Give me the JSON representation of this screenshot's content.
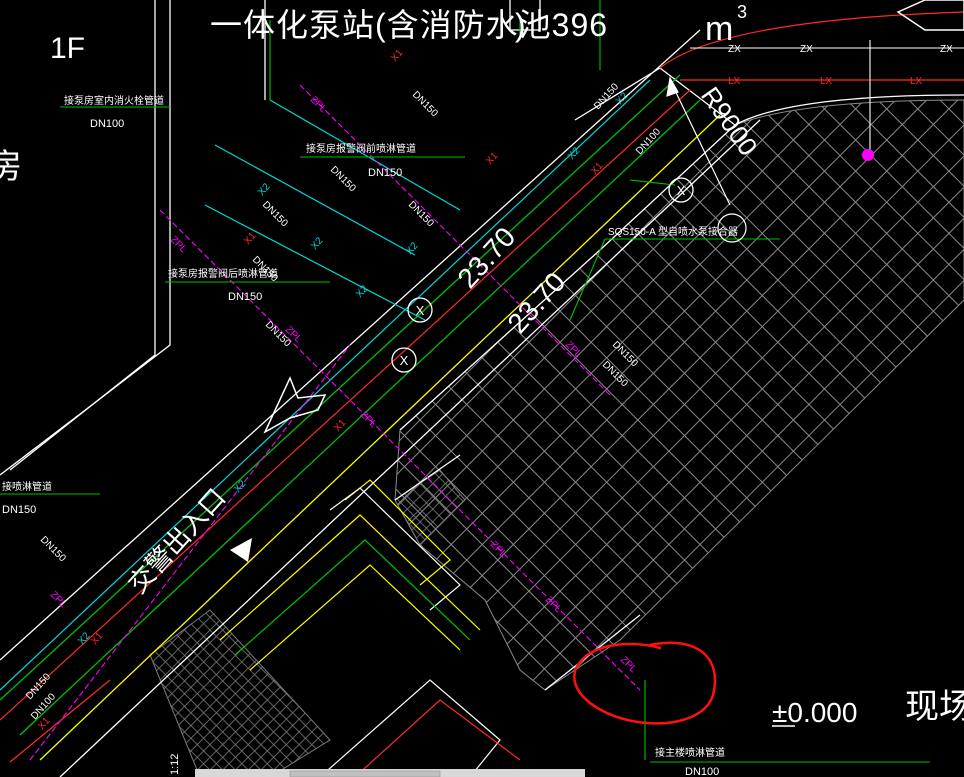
{
  "drawing": {
    "floor_label": "1F",
    "title": "一体化泵站(含消防水池396",
    "title_unit": "m",
    "title_unit_superscript": "3",
    "title_close": ")",
    "radius": "R9000",
    "elevation_1": "23.70",
    "elevation_2": "23.70",
    "ground_level": "±0.000",
    "site_label": "现场",
    "left_partial_char": "房",
    "entrance_label": "交警出入口",
    "scale_mark": "1:12",
    "notes": {
      "indoor_hydrant": "接泵房室内消火栓管道",
      "indoor_hydrant_dn": "DN100",
      "before_alarm": "接泵房报警阀前喷淋管道",
      "before_alarm_dn": "DN150",
      "after_alarm": "接泵房报警阀后喷淋管道",
      "after_alarm_dn": "DN150",
      "left_sprinkler": "接喷淋管道",
      "left_sprinkler_dn": "DN150",
      "main_sprinkler": "接主楼喷淋管道",
      "main_sprinkler_dn": "DN100",
      "adapter": "SQS150-A 型自喷水泵接合器"
    },
    "pipe_codes": {
      "hydrant_main": "X1",
      "hydrant_branch": "X2",
      "sprinkler": "ZPL",
      "sprinkler_alt": "ZX",
      "drain": "LX",
      "pipe_size_150": "DN150",
      "pipe_size_100": "DN100"
    },
    "marker_symbol": "X",
    "colors": {
      "background": "#000000",
      "white": "#ffffff",
      "yellow": "#ffff00",
      "green": "#00c000",
      "cyan": "#00d8d8",
      "red": "#ff2a2a",
      "magenta": "#ff00ff",
      "gray": "#9a9a9a",
      "highlight_circle": "#ff1010"
    }
  }
}
